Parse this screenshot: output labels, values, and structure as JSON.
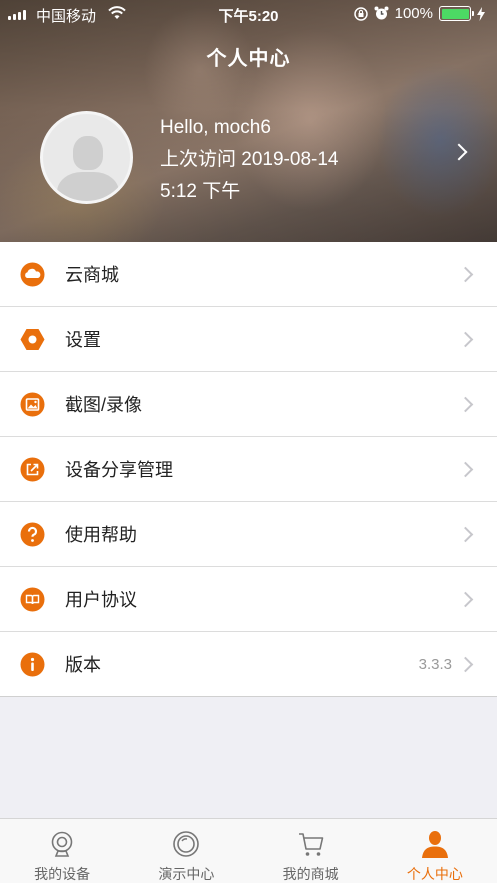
{
  "statusbar": {
    "carrier": "中国移动",
    "time": "下午5:20",
    "battery": "100%",
    "battery_color": "#4cd964"
  },
  "header": {
    "title": "个人中心",
    "greeting": "Hello, moch6",
    "last_visit_line1": "上次访问 2019-08-14",
    "last_visit_line2": "5:12 下午"
  },
  "accent_color": "#e96f0c",
  "menu": {
    "items": [
      {
        "label": "云商城",
        "icon": "cloud-icon",
        "value": ""
      },
      {
        "label": "设置",
        "icon": "settings-hexagon-icon",
        "value": ""
      },
      {
        "label": "截图/录像",
        "icon": "image-icon",
        "value": ""
      },
      {
        "label": "设备分享管理",
        "icon": "share-icon",
        "value": ""
      },
      {
        "label": "使用帮助",
        "icon": "help-icon",
        "value": ""
      },
      {
        "label": "用户协议",
        "icon": "book-icon",
        "value": ""
      },
      {
        "label": "版本",
        "icon": "info-icon",
        "value": "3.3.3"
      }
    ]
  },
  "tabbar": {
    "tabs": [
      {
        "label": "我的设备",
        "icon": "camera-icon",
        "active": false
      },
      {
        "label": "演示中心",
        "icon": "lens-icon",
        "active": false
      },
      {
        "label": "我的商城",
        "icon": "cart-icon",
        "active": false
      },
      {
        "label": "个人中心",
        "icon": "person-icon",
        "active": true
      }
    ]
  }
}
